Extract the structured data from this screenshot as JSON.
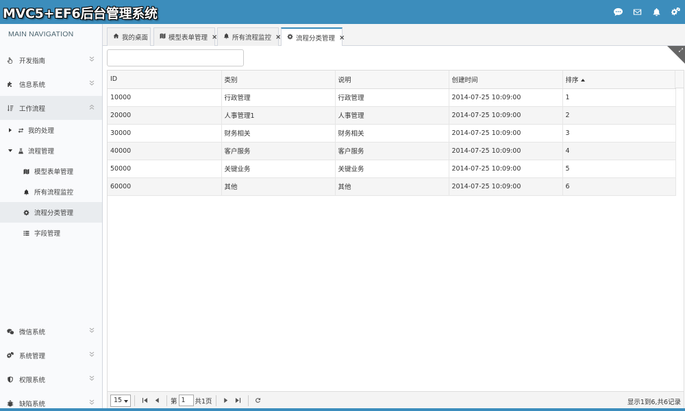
{
  "header": {
    "title": "MVC5+EF6后台管理系统",
    "icons": [
      "comment-icon",
      "envelope-icon",
      "bell-icon",
      "cogs-icon"
    ]
  },
  "sidebar": {
    "heading": "MAIN NAVIGATION",
    "items": [
      {
        "label": "开发指南",
        "icon": "hand-icon"
      },
      {
        "label": "信息系统",
        "icon": "puzzle-icon"
      },
      {
        "label": "工作流程",
        "icon": "sort-icon"
      },
      {
        "label": "微信系统",
        "icon": "wechat-icon"
      },
      {
        "label": "系统管理",
        "icon": "cogs-icon"
      },
      {
        "label": "权限系统",
        "icon": "shield-icon"
      },
      {
        "label": "缺陷系统",
        "icon": "bug-icon"
      }
    ],
    "workflow_children": [
      {
        "label": "我的处理",
        "icon": "refresh-icon"
      },
      {
        "label": "流程管理",
        "icon": "flask-icon"
      }
    ],
    "process_children": [
      {
        "label": "模型表单管理",
        "icon": "map-icon"
      },
      {
        "label": "所有流程监控",
        "icon": "bell-icon"
      },
      {
        "label": "流程分类管理",
        "icon": "gear-icon"
      },
      {
        "label": "字段管理",
        "icon": "list-icon"
      }
    ]
  },
  "tabs": [
    {
      "label": "我的桌面",
      "icon": "home-icon",
      "closable": false
    },
    {
      "label": "模型表单管理",
      "icon": "map-icon",
      "closable": true
    },
    {
      "label": "所有流程监控",
      "icon": "bell-icon",
      "closable": true
    },
    {
      "label": "流程分类管理",
      "icon": "gear-icon",
      "closable": true,
      "active": true
    }
  ],
  "grid": {
    "columns": [
      "ID",
      "类别",
      "说明",
      "创建时间",
      "排序"
    ],
    "sort_column": "排序",
    "sort_direction": "asc",
    "rows": [
      [
        "10000",
        "行政管理",
        "行政管理",
        "2014-07-25 10:09:00",
        "1"
      ],
      [
        "20000",
        "人事管理1",
        "人事管理",
        "2014-07-25 10:09:00",
        "2"
      ],
      [
        "30000",
        "财务相关",
        "财务相关",
        "2014-07-25 10:09:00",
        "3"
      ],
      [
        "40000",
        "客户服务",
        "客户服务",
        "2014-07-25 10:09:00",
        "4"
      ],
      [
        "50000",
        "关键业务",
        "关键业务",
        "2014-07-25 10:09:00",
        "5"
      ],
      [
        "60000",
        "其他",
        "其他",
        "2014-07-25 10:09:00",
        "6"
      ]
    ]
  },
  "pager": {
    "page_size": "15",
    "page_prefix": "第",
    "page_value": "1",
    "page_total": "共1页",
    "info": "显示1到6,共6记录"
  },
  "colors": {
    "primary": "#3c8dbc",
    "sidebar_bg": "#f9fafc",
    "active_bg": "#e9ecef"
  }
}
